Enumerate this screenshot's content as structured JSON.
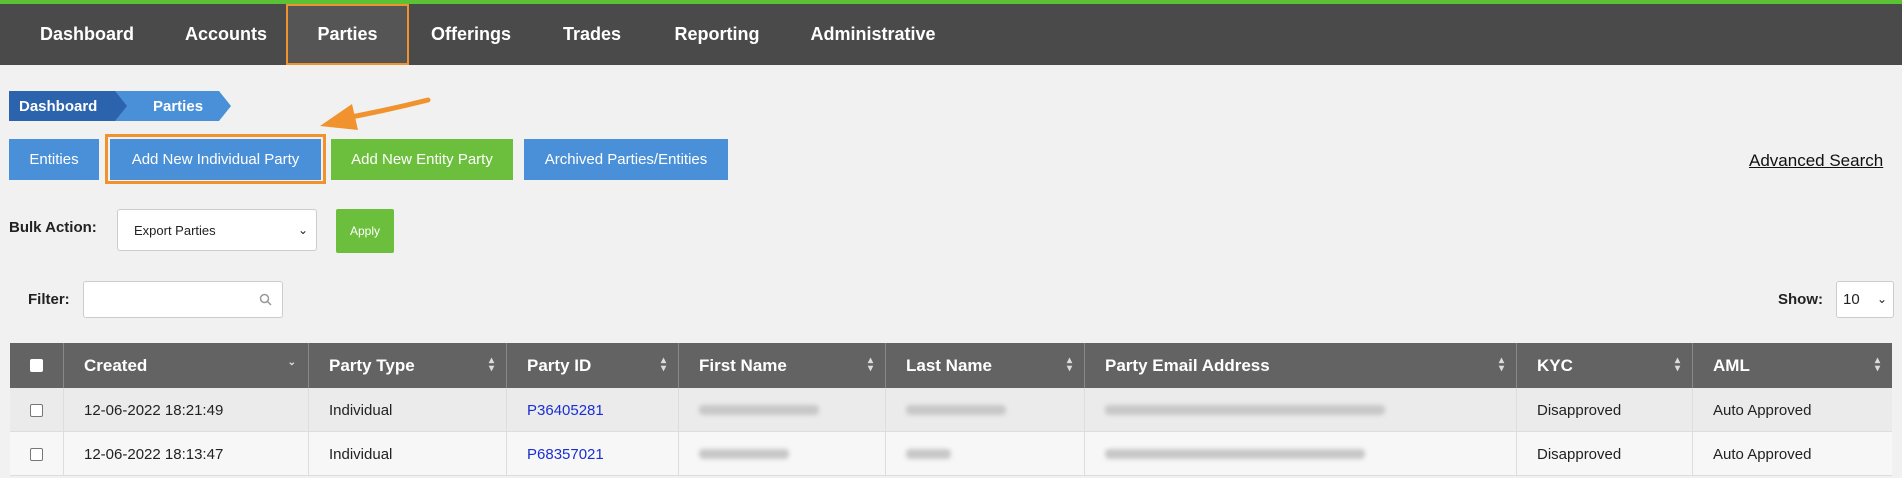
{
  "nav": {
    "items": [
      "Dashboard",
      "Accounts",
      "Parties",
      "Offerings",
      "Trades",
      "Reporting",
      "Administrative"
    ],
    "active": "Parties"
  },
  "breadcrumb": [
    "Dashboard",
    "Parties"
  ],
  "actions": {
    "entities": "Entities",
    "add_individual": "Add New Individual Party",
    "add_entity": "Add New Entity Party",
    "archived": "Archived Parties/Entities",
    "advanced_search": "Advanced Search"
  },
  "bulk": {
    "label": "Bulk Action:",
    "selected": "Export Parties",
    "apply": "Apply"
  },
  "filter": {
    "label": "Filter:",
    "value": ""
  },
  "show": {
    "label": "Show:",
    "value": "10"
  },
  "table": {
    "columns": [
      "Created",
      "Party Type",
      "Party ID",
      "First Name",
      "Last Name",
      "Party Email Address",
      "KYC",
      "AML"
    ],
    "rows": [
      {
        "created": "12-06-2022 18:21:49",
        "party_type": "Individual",
        "party_id": "P36405281",
        "kyc": "Disapproved",
        "aml": "Auto Approved"
      },
      {
        "created": "12-06-2022 18:13:47",
        "party_type": "Individual",
        "party_id": "P68357021",
        "kyc": "Disapproved",
        "aml": "Auto Approved"
      }
    ]
  },
  "colors": {
    "nav_bg": "#4a4a4a",
    "accent_green": "#6cbf3c",
    "accent_blue": "#4a90d9",
    "highlight_orange": "#f0922d",
    "link_blue": "#1a2fd0"
  }
}
